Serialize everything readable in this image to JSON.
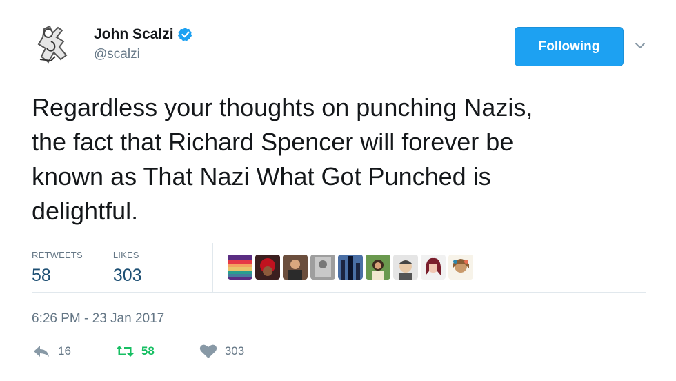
{
  "user": {
    "display_name": "John Scalzi",
    "handle": "@scalzi",
    "verified_icon": "verified-badge-icon"
  },
  "follow_button": {
    "label": "Following"
  },
  "tweet": {
    "text": "Regardless your thoughts on punching Nazis,\nthe fact that Richard Spencer will forever be\nknown as That Nazi What Got Punched is\ndelightful."
  },
  "stats": {
    "retweets_label": "RETWEETS",
    "retweets_value": "58",
    "likes_label": "LIKES",
    "likes_value": "303"
  },
  "timestamp": "6:26 PM - 23 Jan 2017",
  "actions": {
    "reply_count": "16",
    "retweet_count": "58",
    "like_count": "303"
  },
  "colors": {
    "accent": "#1da1f2",
    "retweet_green": "#17bf63",
    "muted": "#657786",
    "stat_value": "#1d4f73"
  }
}
